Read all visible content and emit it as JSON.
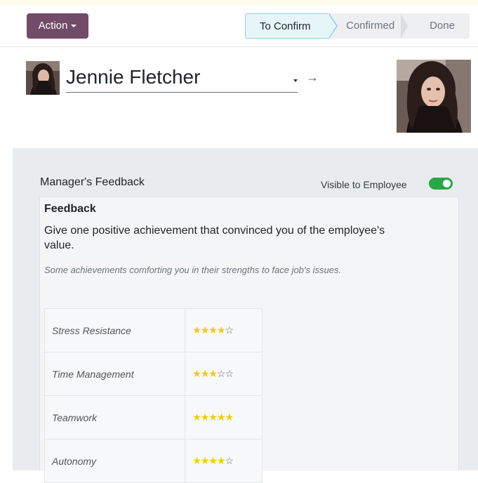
{
  "control_panel": {
    "action_label": "Action",
    "stages": [
      {
        "label": "To Confirm",
        "active": true
      },
      {
        "label": "Confirmed",
        "active": false
      },
      {
        "label": "Done",
        "active": false
      }
    ]
  },
  "header": {
    "employee_name": "Jennie Fletcher"
  },
  "feedback_section": {
    "title": "Manager's Feedback",
    "visibility_label": "Visible to Employee",
    "visible": true,
    "heading": "Feedback",
    "question": "Give one positive achievement that convinced you of the employee's value.",
    "description": "Some achievements comforting you in their strengths to face job's issues.",
    "ratings": [
      {
        "label": "Stress Resistance",
        "stars": 4,
        "max": 5
      },
      {
        "label": "Time Management",
        "stars": 3,
        "max": 5
      },
      {
        "label": "Teamwork",
        "stars": 5,
        "max": 5
      },
      {
        "label": "Autonomy",
        "stars": 4,
        "max": 5
      }
    ]
  },
  "colors": {
    "brand": "#714b67",
    "toggle_on": "#28a745",
    "star_full": "#f3cc00",
    "active_stage": "#e6f5f7"
  }
}
